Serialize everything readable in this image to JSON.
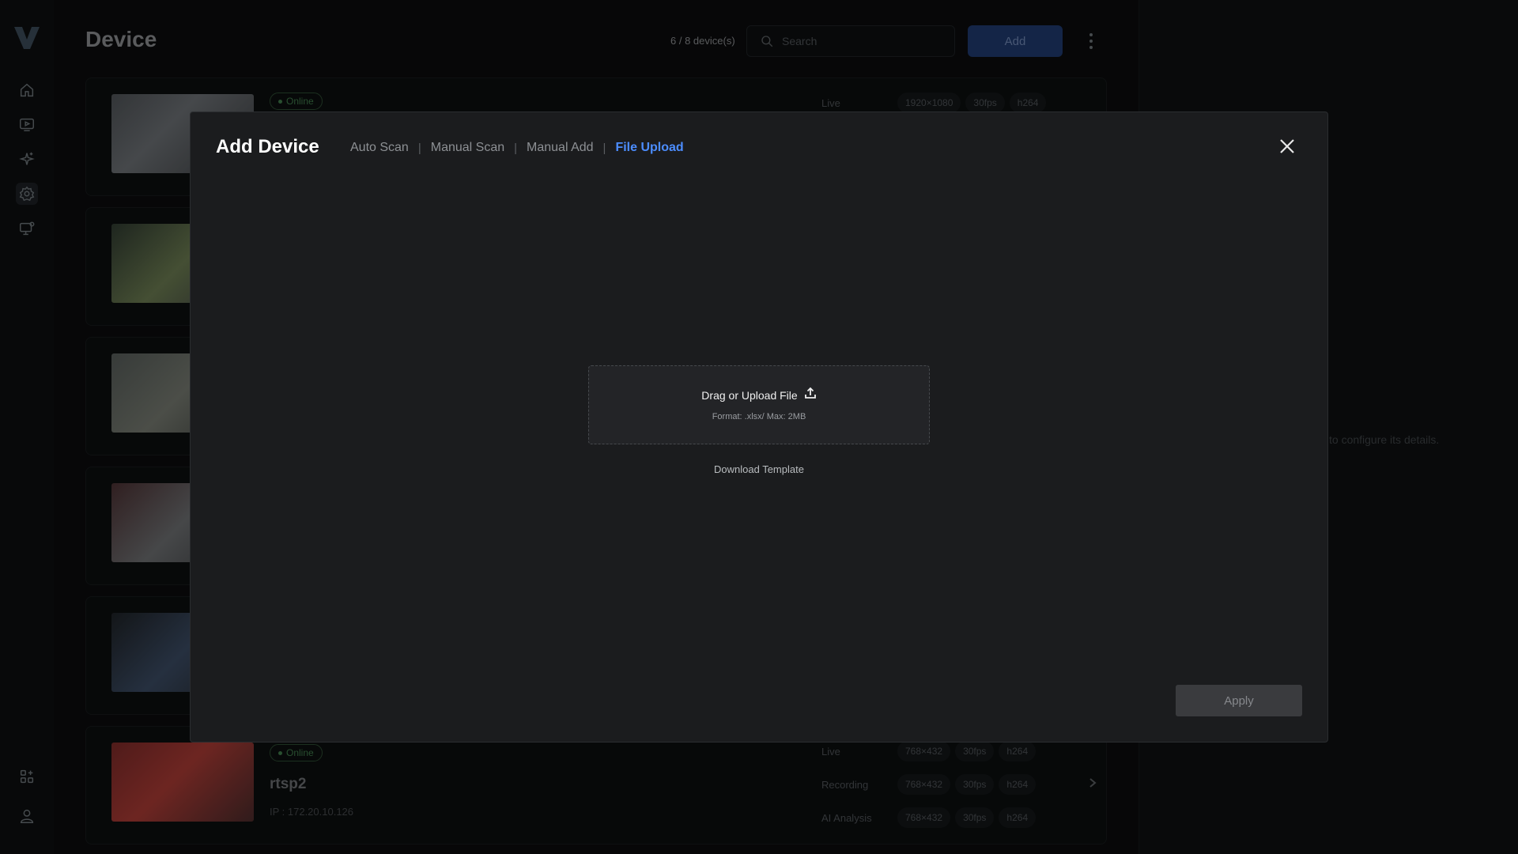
{
  "page": {
    "title": "Device",
    "device_count": "6 / 8 device(s)",
    "search_placeholder": "Search",
    "add_label": "Add",
    "right_hint": "to configure its details."
  },
  "devices": [
    {
      "status": "Online",
      "name": "",
      "ip": "",
      "streams": [
        {
          "label": "Live",
          "resolution": "1920×1080",
          "fps": "30fps",
          "codec": "h264"
        }
      ]
    },
    {
      "status": "Online",
      "name": "rtsp2",
      "ip": "IP : 172.20.10.126",
      "streams": [
        {
          "label": "Live",
          "resolution": "768×432",
          "fps": "30fps",
          "codec": "h264"
        },
        {
          "label": "Recording",
          "resolution": "768×432",
          "fps": "30fps",
          "codec": "h264"
        },
        {
          "label": "AI Analysis",
          "resolution": "768×432",
          "fps": "30fps",
          "codec": "h264"
        }
      ]
    }
  ],
  "modal": {
    "title": "Add Device",
    "tabs": [
      "Auto Scan",
      "Manual Scan",
      "Manual Add",
      "File Upload"
    ],
    "active_tab": "File Upload",
    "upload_title": "Drag or Upload File",
    "upload_hint": "Format: .xlsx/ Max: 2MB",
    "download_template": "Download Template",
    "apply_label": "Apply"
  },
  "colors": {
    "accent": "#4c8dff",
    "online": "#3f7a4a",
    "modal_bg": "#1b1c1e"
  },
  "icons": {
    "sidebar": [
      "home-icon",
      "playback-icon",
      "ai-sparkle-icon",
      "settings-icon",
      "monitor-user-icon",
      "apps-add-icon",
      "user-icon"
    ]
  }
}
